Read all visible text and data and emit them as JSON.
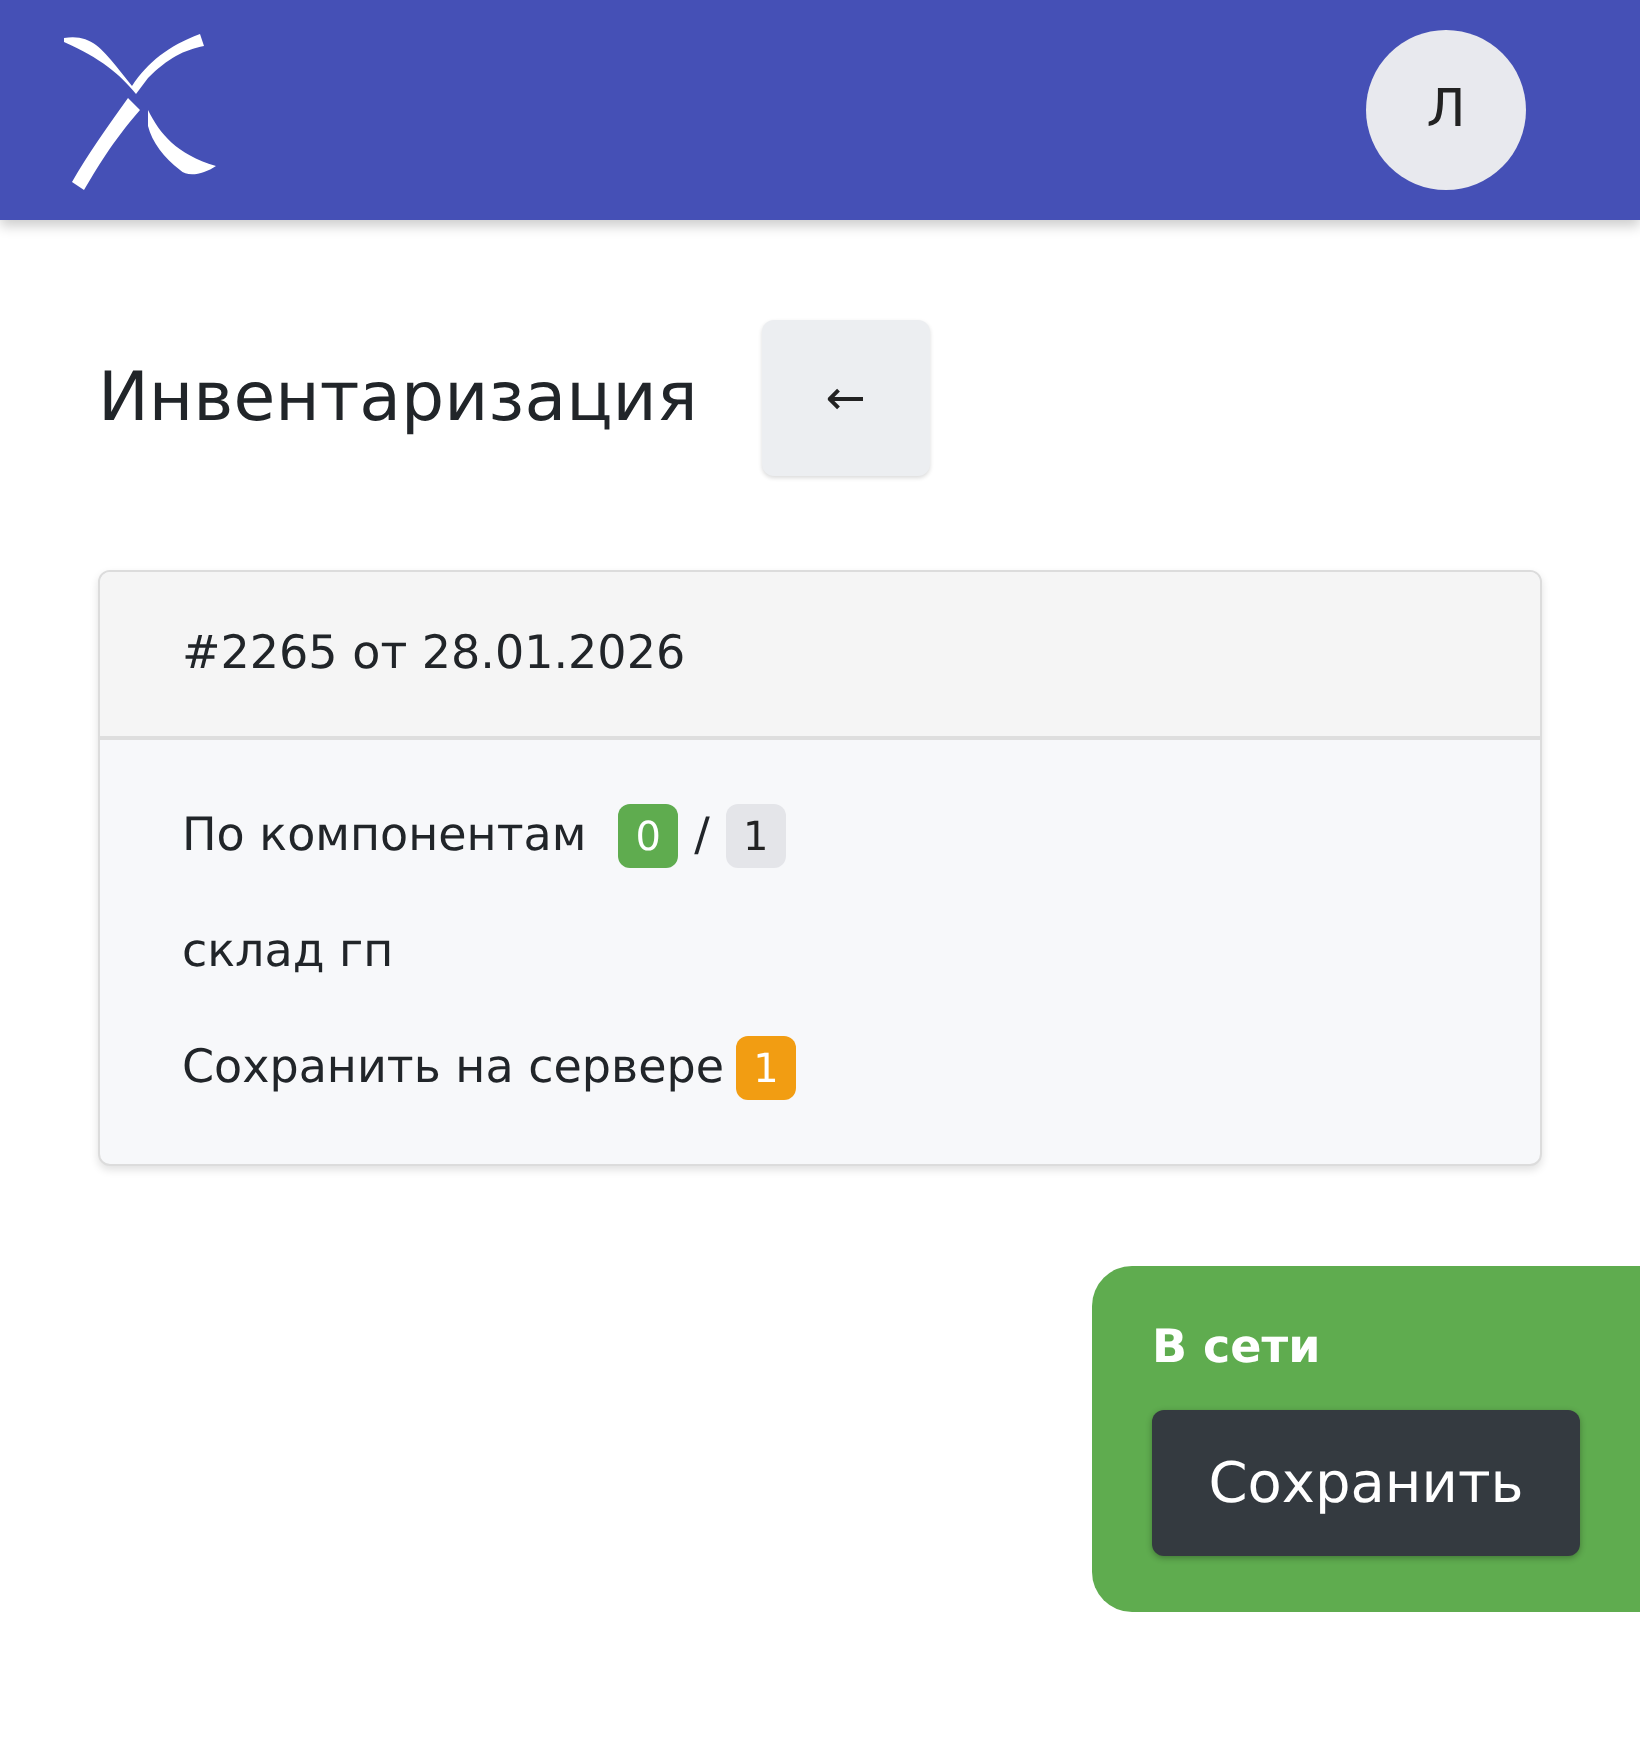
{
  "header": {
    "avatar": "Л"
  },
  "page": {
    "title": "Инвентаризация",
    "back": "←"
  },
  "card": {
    "title": "#2265 от 28.01.2026",
    "components": {
      "label": "По компонентам",
      "done": {
        "text": "0",
        "color": "#5fac4f"
      },
      "separator": "/",
      "total": {
        "text": "1",
        "color": "#e4e5e9"
      }
    },
    "location": "склад гп",
    "pending": {
      "label": "Сохранить на сервере",
      "count": {
        "text": "1",
        "color": "#f29d12"
      }
    }
  },
  "status": {
    "online": true,
    "label": "В сети",
    "button": "Сохранить"
  }
}
